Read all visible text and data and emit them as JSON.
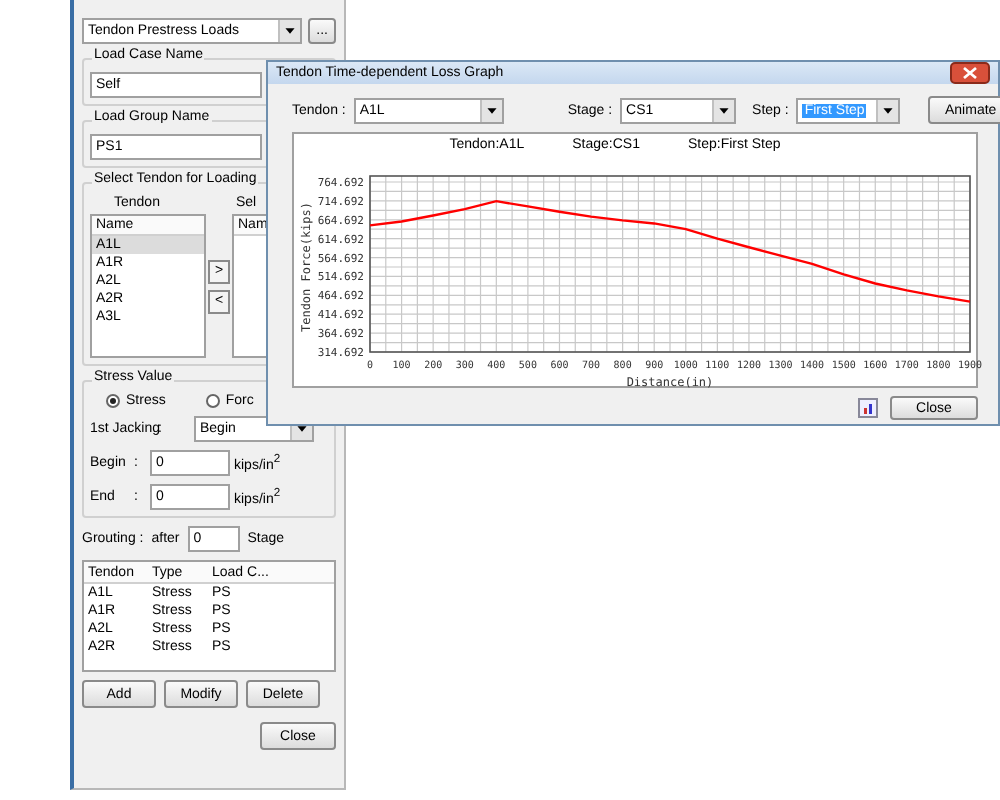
{
  "left_panel": {
    "load_type": {
      "value": "Tendon Prestress Loads",
      "button": "..."
    },
    "load_case": {
      "label": "Load Case Name",
      "value": "Self"
    },
    "load_group": {
      "label": "Load Group Name",
      "value": "PS1"
    },
    "select_tendon": {
      "label": "Select Tendon for Loading",
      "tendon_label": "Tendon",
      "selected_label": "Sel",
      "list_header": "Name",
      "selected_list_header": "Nam",
      "add_button": ">",
      "remove_button": "<",
      "items": [
        {
          "label": "A1L",
          "selected": true
        },
        {
          "label": "A1R",
          "selected": false
        },
        {
          "label": "A2L",
          "selected": false
        },
        {
          "label": "A2R",
          "selected": false
        },
        {
          "label": "A3L",
          "selected": false
        }
      ]
    },
    "stress_value": {
      "label": "Stress Value",
      "options": [
        {
          "label": "Stress",
          "selected": true
        },
        {
          "label": "Forc",
          "selected": false
        }
      ],
      "jacking_label": "1st Jacking",
      "jacking_colon": ":",
      "jacking_value": "Begin",
      "fields": [
        {
          "label": "Begin",
          "colon": ":",
          "value": "0",
          "unit": "kips/in$^{2}$"
        },
        {
          "label": "End",
          "colon": ":",
          "value": "0",
          "unit": "kips/in$^{2}$"
        }
      ]
    },
    "grouting": {
      "label": "Grouting :",
      "after": "after",
      "value": "0",
      "unit": "Stage"
    },
    "table": {
      "columns": [
        "Tendon",
        "Type",
        "Load C..."
      ],
      "rows": [
        [
          "A1L",
          "Stress",
          "PS"
        ],
        [
          "A1R",
          "Stress",
          "PS"
        ],
        [
          "A2L",
          "Stress",
          "PS"
        ],
        [
          "A2R",
          "Stress",
          "PS"
        ]
      ]
    },
    "buttons": [
      "Add",
      "Modify",
      "Delete"
    ],
    "close_button": "Close"
  },
  "dialog": {
    "title": "Tendon Time-dependent Loss Graph",
    "controls": [
      {
        "label": "Tendon :",
        "value": "A1L"
      },
      {
        "label": "Stage :",
        "value": "CS1"
      },
      {
        "label": "Step :",
        "value": "First Step"
      }
    ],
    "animate_button": "Animate",
    "captions": [
      "Tendon:A1L",
      "Stage:CS1",
      "Step:First Step"
    ],
    "chart_data": {
      "type": "line",
      "xlabel": "Distance(in)",
      "ylabel": "Tendon Force(kips)",
      "x": [
        0,
        100,
        200,
        300,
        400,
        500,
        600,
        700,
        800,
        900,
        1000,
        1100,
        1200,
        1300,
        1400,
        1500,
        1600,
        1700,
        1800,
        1900
      ],
      "grid": true,
      "series": [
        {
          "color": "#ff0000",
          "values": [
            650,
            660,
            676,
            693,
            714,
            700,
            686,
            673,
            663,
            655,
            640,
            615,
            592,
            570,
            548,
            520,
            496,
            478,
            462,
            448
          ]
        }
      ],
      "xlim": [
        0,
        1900
      ],
      "ylim": [
        314.692,
        764.692
      ],
      "xticks": [
        0,
        100,
        200,
        300,
        400,
        500,
        600,
        700,
        800,
        900,
        1000,
        1100,
        1200,
        1300,
        1400,
        1500,
        1600,
        1700,
        1800,
        1900
      ],
      "yticks": [
        {
          "value": 764.692,
          "label": "764.692"
        },
        {
          "value": 714.692,
          "label": "714.692"
        },
        {
          "value": 664.692,
          "label": "664.692"
        },
        {
          "value": 614.692,
          "label": "614.692"
        },
        {
          "value": 564.692,
          "label": "564.692"
        },
        {
          "value": 514.692,
          "label": "514.692"
        },
        {
          "value": 464.692,
          "label": "464.692"
        },
        {
          "value": 414.692,
          "label": "414.692"
        },
        {
          "value": 364.692,
          "label": "364.692"
        },
        {
          "value": 314.692,
          "label": "314.692"
        }
      ]
    },
    "close_button": "Close"
  }
}
